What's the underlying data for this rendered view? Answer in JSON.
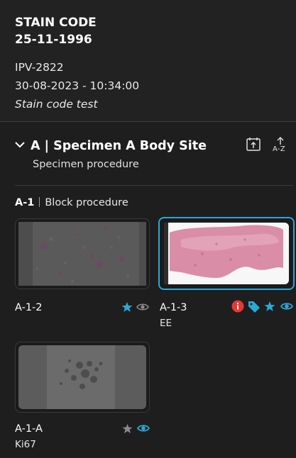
{
  "header": {
    "title": "STAIN CODE",
    "date": "25-11-1996",
    "case_id": "IPV-2822",
    "timestamp": "30-08-2023 - 10:34:00",
    "note": "Stain code test"
  },
  "specimen": {
    "title": "A | Specimen A Body Site",
    "procedure": "Specimen procedure",
    "sort_label": "A-Z"
  },
  "block": {
    "id": "A-1",
    "procedure": "Block procedure"
  },
  "slides": [
    {
      "label": "A-1-2",
      "sub": "",
      "icons": [
        "star-icon",
        "eye-icon"
      ],
      "selected": false
    },
    {
      "label": "A-1-3",
      "sub": "EE",
      "icons": [
        "info-icon",
        "tag-icon",
        "star-icon",
        "eye-icon"
      ],
      "selected": true
    },
    {
      "label": "A-1-A",
      "sub": "Ki67",
      "icons": [
        "star-icon",
        "eye-icon"
      ],
      "selected": false
    }
  ],
  "colors": {
    "accent": "#2aa8d8",
    "danger": "#e53935",
    "background": "#1e1e1e"
  }
}
